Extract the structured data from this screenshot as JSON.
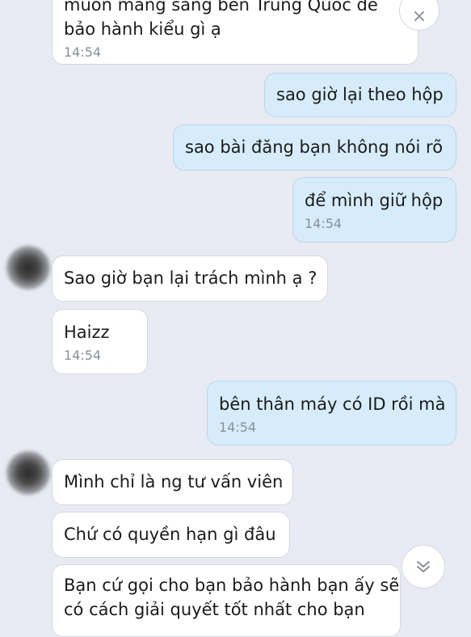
{
  "messages": [
    {
      "side": "in",
      "text": [
        "muốn mang sang bên Trung Quốc để",
        "bảo hành kiểu gì ạ"
      ],
      "time": "14:54"
    },
    {
      "side": "out",
      "text": [
        "sao giờ lại theo hộp"
      ]
    },
    {
      "side": "out",
      "text": [
        "sao bài đăng bạn không nói rõ"
      ]
    },
    {
      "side": "out",
      "text": [
        "để mình giữ hộp"
      ],
      "time": "14:54"
    },
    {
      "side": "in",
      "text": [
        "Sao giờ bạn lại trách mình ạ ?"
      ]
    },
    {
      "side": "in",
      "text": [
        "Haizz"
      ],
      "time": "14:54"
    },
    {
      "side": "out",
      "text": [
        "bên thân máy có ID rồi mà"
      ],
      "time": "14:54"
    },
    {
      "side": "in",
      "text": [
        "Mình chỉ là ng tư vấn viên"
      ]
    },
    {
      "side": "in",
      "text": [
        "Chứ có quyền hạn gì đâu"
      ]
    },
    {
      "side": "in",
      "text": [
        "Bạn cứ gọi cho bạn bảo hành bạn ấy sẽ",
        "có cách giải quyết tốt nhất cho bạn"
      ]
    }
  ],
  "controls": {
    "close_icon": "×",
    "scroll_down_icon": "⌄⌄"
  }
}
